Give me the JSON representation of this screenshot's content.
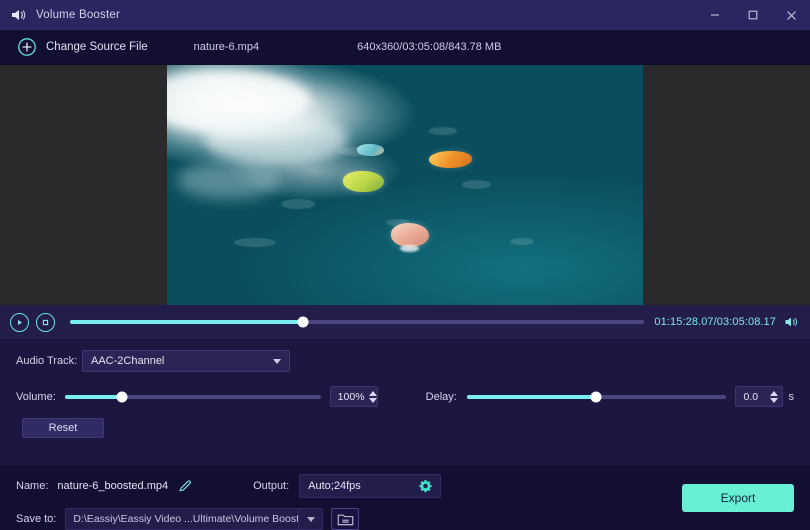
{
  "window": {
    "title": "Volume Booster",
    "app_icon": "volume-speaker-icon",
    "minimize": "–",
    "maximize": "□",
    "close": "✕"
  },
  "header": {
    "change_source_label": "Change Source File",
    "plus_icon": "plus-circle-icon",
    "file_name": "nature-6.mp4",
    "file_meta": "640x360/03:05:08/843.78 MB"
  },
  "preview": {
    "description": "aerial-ocean-swimmers-video-frame"
  },
  "playback": {
    "play_icon": "play-circle-icon",
    "stop_icon": "stop-circle-icon",
    "progress_percent": 40.5,
    "time_readout": "01:15:28.07/03:05:08.17",
    "current_time": "01:15:28.07",
    "total_time": "03:05:08.17",
    "speaker_icon": "speaker-wave-icon"
  },
  "controls": {
    "audio_track_label": "Audio Track:",
    "audio_track_value": "AAC-2Channel",
    "audio_track_options": [
      "AAC-2Channel"
    ],
    "volume_label": "Volume:",
    "volume_percent": 100,
    "volume_value": "100%",
    "volume_slider_fill": 22.5,
    "delay_label": "Delay:",
    "delay_value": "0.0",
    "delay_unit": "s",
    "delay_slider_fill": 50,
    "reset_label": "Reset"
  },
  "output": {
    "name_label": "Name:",
    "name_value": "nature-6_boosted.mp4",
    "pencil_icon": "pencil-edit-icon",
    "output_label": "Output:",
    "output_value": "Auto;24fps",
    "gear_icon": "gear-settings-icon",
    "save_to_label": "Save to:",
    "save_to_value": "D:\\Eassiy\\Eassiy Video ...Ultimate\\Volume Booster",
    "folder_icon": "folder-open-icon",
    "export_label": "Export"
  },
  "colors": {
    "accent_cyan": "#79eef0",
    "accent_mint": "#69f0d4",
    "titlebar_bg": "#2b2560",
    "panel_bg": "#1b1740",
    "header_bg": "#130f33",
    "time_text": "#7ee7e4"
  }
}
